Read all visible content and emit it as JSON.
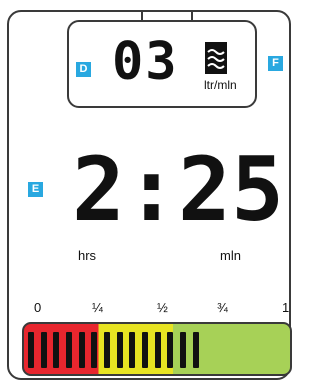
{
  "flow": {
    "tag": "D",
    "value": "03",
    "unit": "ltr/mln",
    "icon": "water-flow-icon"
  },
  "tag_f": "F",
  "timer": {
    "tag": "E",
    "value": "2:25",
    "hours_label": "hrs",
    "minutes_label": "mln"
  },
  "scale": {
    "labels": [
      "0",
      "¼",
      "½",
      "¾",
      "1"
    ]
  },
  "gauge": {
    "level": 0.68,
    "colors": {
      "low": "#e8262e",
      "mid": "#e7e322",
      "high": "#a7d157"
    }
  },
  "colors": {
    "tag": "#29a8e0",
    "border": "#3a3a3a"
  }
}
